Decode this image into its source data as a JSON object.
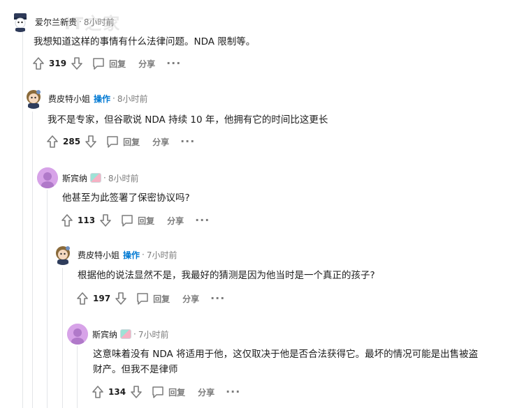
{
  "watermark": "IT之家",
  "comments": [
    {
      "username": "爱尔兰新贵",
      "time": "8小时前",
      "body": "我想知道这样的事情有什么法律问题。NDA 限制等。",
      "votes": "319",
      "reply_label": "回复",
      "share_label": "分享",
      "more_label": "···"
    },
    {
      "username": "费皮特小姐",
      "op_label": "操作",
      "time": "8小时前",
      "body": "我不是专家，但谷歌说 NDA 持续 10 年，他拥有它的时间比这更长",
      "votes": "285",
      "reply_label": "回复",
      "share_label": "分享",
      "more_label": "···"
    },
    {
      "username": "斯宾纳",
      "time": "8小时前",
      "body": "他甚至为此签署了保密协议吗?",
      "votes": "113",
      "reply_label": "回复",
      "share_label": "分享",
      "more_label": "···"
    },
    {
      "username": "费皮特小姐",
      "op_label": "操作",
      "time": "7小时前",
      "body": "根据他的说法显然不是，我最好的猜测是因为他当时是一个真正的孩子?",
      "votes": "197",
      "reply_label": "回复",
      "share_label": "分享",
      "more_label": "···"
    },
    {
      "username": "斯宾纳",
      "time": "7小时前",
      "body_line1": "这意味着没有 NDA 将适用于他，这仅取决于他是否合法获得它。最坏的情况可能是出售被盗",
      "body_line2": "财产。但我不是律师",
      "votes": "134",
      "reply_label": "回复",
      "share_label": "分享",
      "more_label": "···"
    }
  ]
}
